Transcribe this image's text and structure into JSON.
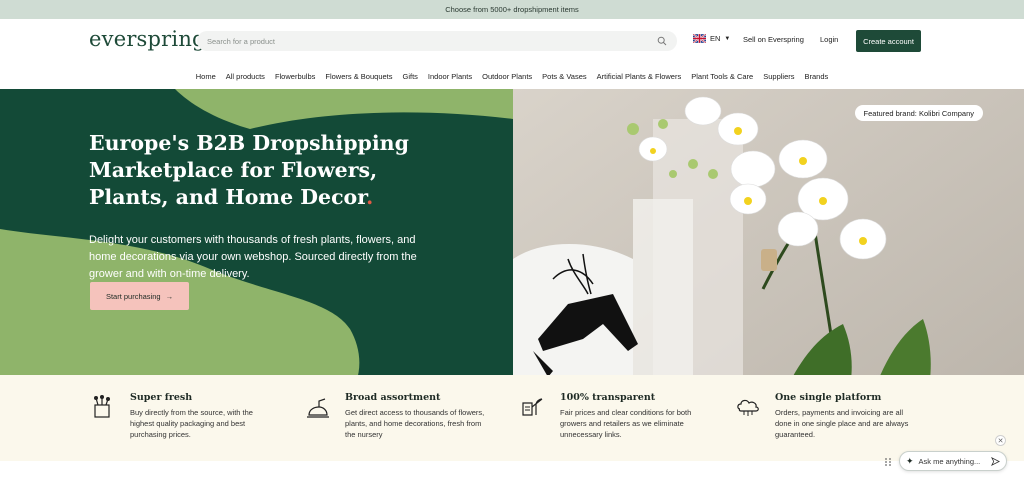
{
  "announcement": "Choose from 5000+ dropshipment items",
  "header": {
    "logo": "everspring",
    "search_placeholder": "Search for a product",
    "language": "EN",
    "sell": "Sell on Everspring",
    "login": "Login",
    "create_account": "Create account"
  },
  "nav": [
    "Home",
    "All products",
    "Flowerbulbs",
    "Flowers & Bouquets",
    "Gifts",
    "Indoor Plants",
    "Outdoor Plants",
    "Pots & Vases",
    "Artificial Plants & Flowers",
    "Plant Tools & Care",
    "Suppliers",
    "Brands"
  ],
  "hero": {
    "title": "Europe's B2B Dropshipping Marketplace for Flowers, Plants, and Home Decor",
    "title_dot": ".",
    "subtitle": "Delight your customers with thousands of fresh plants, flowers, and home decorations via your own webshop. Sourced directly from the grower and with on-time delivery.",
    "cta": "Start purchasing",
    "featured_brand": "Featured brand: Kolibri Company"
  },
  "features": [
    {
      "title": "Super fresh",
      "text": "Buy directly from the source, with the highest quality packaging and best purchasing prices.",
      "icon": "bouquet-box-icon"
    },
    {
      "title": "Broad assortment",
      "text": "Get direct access to thousands of flowers, plants, and home decorations, fresh from the nursery",
      "icon": "watering-can-icon"
    },
    {
      "title": "100% transparent",
      "text": "Fair prices and clear conditions for both growers and retailers as we eliminate unnecessary links.",
      "icon": "plant-tag-icon"
    },
    {
      "title": "One single platform",
      "text": "Orders, payments and invoicing are all done in one single place and are always guaranteed.",
      "icon": "cloud-platform-icon"
    }
  ],
  "chat": {
    "placeholder": "Ask me anything..."
  },
  "colors": {
    "brand_green": "#1e4a38",
    "hero_green": "#134a37",
    "light_green": "#8fb46a",
    "cta_pink": "#f5c3bc",
    "cream": "#fbf8ec",
    "announce": "#cfdcd3"
  }
}
